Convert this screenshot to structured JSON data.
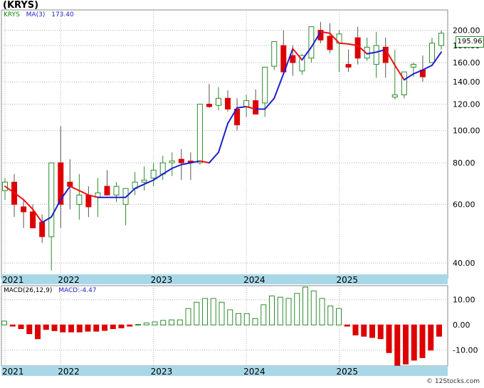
{
  "header": {
    "ticker": "(KRYS)",
    "legend_symbol": "KRYS",
    "legend_ma": "MA(3)",
    "legend_ma_value": "173.40",
    "last_price": "195.96",
    "macd_label": "MACD(26,12,9)",
    "macd_value": "MACD:-4.47",
    "watermark": "© 12Stocks.com"
  },
  "colors": {
    "up": "#2e8b2e",
    "down": "#dd0000",
    "ma_up": "#1f1fd0",
    "ma_down": "#ee1111",
    "axis_band": "#a8d8e8",
    "grid": "#b0b0b0"
  },
  "chart_data": [
    {
      "type": "candlestick",
      "panel": "price",
      "y_scale": "log",
      "ylim": [
        37,
        228
      ],
      "y_ticks": [
        40,
        60,
        80,
        100,
        120,
        140,
        160,
        180,
        200
      ],
      "y_tick_labels": [
        "40.00",
        "60.00",
        "80.00",
        "100.00",
        "120.00",
        "140.00",
        "160.00",
        "180.00",
        "200.00"
      ],
      "x_ticks": [
        "2021",
        "2022",
        "2023",
        "2024",
        "2025"
      ],
      "x_tick_index": [
        0,
        6,
        16,
        26,
        36
      ],
      "series": [
        {
          "kind": "ohlc",
          "open": [
            66,
            70,
            59,
            57,
            53,
            48,
            80,
            70,
            60,
            64,
            63,
            68,
            64,
            60,
            67,
            70,
            72,
            74,
            80,
            82,
            81,
            80,
            120,
            119,
            125,
            116,
            118,
            123,
            121,
            156,
            180,
            168,
            151,
            165,
            200,
            192,
            183,
            158,
            190,
            165,
            158,
            178,
            126,
            128,
            155,
            152,
            160,
            180
          ],
          "high": [
            72,
            74,
            62,
            60,
            56,
            52,
            103,
            82,
            74,
            68,
            72,
            76,
            70,
            66,
            75,
            78,
            80,
            84,
            86,
            88,
            86,
            86,
            138,
            135,
            132,
            125,
            128,
            133,
            126,
            185,
            200,
            180,
            170,
            205,
            212,
            210,
            200,
            175,
            205,
            190,
            198,
            190,
            175,
            150,
            160,
            168,
            190,
            200
          ],
          "low": [
            62,
            55,
            51,
            51,
            46,
            38,
            51,
            58,
            54,
            55,
            55,
            65,
            61,
            52,
            64,
            66,
            68,
            71,
            73,
            71,
            71,
            79,
            117,
            115,
            114,
            100,
            110,
            112,
            110,
            152,
            148,
            146,
            147,
            160,
            183,
            171,
            150,
            150,
            158,
            162,
            144,
            144,
            124,
            125,
            145,
            140,
            160,
            175
          ],
          "close": [
            70,
            60,
            57,
            51,
            48,
            80,
            60,
            68,
            64,
            59,
            65,
            64,
            68,
            67,
            70,
            71,
            76,
            80,
            81,
            80,
            80,
            120,
            118,
            125,
            116,
            104,
            123,
            112,
            155,
            185,
            150,
            160,
            168,
            205,
            187,
            175,
            195,
            155,
            165,
            178,
            180,
            160,
            128,
            150,
            158,
            145,
            183,
            196
          ]
        },
        {
          "kind": "line",
          "name": "MA(3)",
          "values": [
            68,
            65,
            62,
            58,
            53,
            55,
            62,
            68,
            66,
            64,
            63,
            63,
            63,
            63,
            67,
            69,
            71,
            74,
            77,
            79,
            80,
            81,
            80,
            86,
            105,
            117,
            118,
            116,
            116,
            125,
            148,
            176,
            163,
            178,
            198,
            196,
            183,
            182,
            180,
            170,
            172,
            175,
            157,
            142,
            148,
            152,
            157,
            172
          ]
        }
      ]
    },
    {
      "type": "bar",
      "panel": "macd",
      "ylim": [
        -16,
        15
      ],
      "y_ticks": [
        10,
        0,
        -10
      ],
      "y_tick_labels": [
        "10.00",
        "0.00",
        "-10.00"
      ],
      "x_ticks": [
        "2021",
        "2022",
        "2023",
        "2024",
        "2025"
      ],
      "x_tick_index": [
        0,
        6,
        16,
        26,
        36
      ],
      "values": [
        1.5,
        -0.5,
        -1.5,
        -3.5,
        -5.5,
        -1.8,
        -2.3,
        -2.8,
        -2.8,
        -2.8,
        -2.5,
        -2.5,
        -2.2,
        -1.5,
        -1.2,
        -0.5,
        0.2,
        0.8,
        1.2,
        1.8,
        2.0,
        2.0,
        6.5,
        9.0,
        10.5,
        10.5,
        9.0,
        6.0,
        4.5,
        4.5,
        2.5,
        8.0,
        11.5,
        11.0,
        10.5,
        12.5,
        15.0,
        13.5,
        10.5,
        7.5,
        6.5,
        -0.5,
        -4.0,
        -4.5,
        -5.0,
        -5.5,
        -11.0,
        -16.0,
        -15.5,
        -14.0,
        -13.0,
        -10.0,
        -4.5
      ]
    }
  ]
}
